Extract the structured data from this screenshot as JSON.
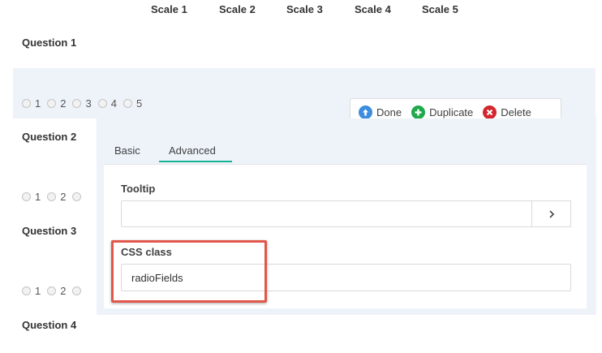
{
  "scale_headers": [
    "Scale 1",
    "Scale 2",
    "Scale 3",
    "Scale 4",
    "Scale 5"
  ],
  "questions": [
    {
      "label": "Question 1"
    },
    {
      "label": "Question 2"
    },
    {
      "label": "Question 3"
    },
    {
      "label": "Question 4"
    }
  ],
  "q1_options": [
    "1",
    "2",
    "3",
    "4",
    "5"
  ],
  "q2_options": [
    "1",
    "2"
  ],
  "q3_options": [
    "1",
    "2"
  ],
  "toolbar": {
    "done_label": "Done",
    "duplicate_label": "Duplicate",
    "delete_label": "Delete"
  },
  "tabs": [
    {
      "label": "Basic",
      "active": false
    },
    {
      "label": "Advanced",
      "active": true
    }
  ],
  "fields": {
    "tooltip_label": "Tooltip",
    "tooltip_value": "",
    "css_label": "CSS class",
    "css_value": "radioFields"
  },
  "colors": {
    "accent": "#19b394",
    "done_icon": "#3c8dde",
    "duplicate_icon": "#1ea94b",
    "delete_icon": "#d3262d",
    "highlight": "#e2574c",
    "selected_bg": "#eef3fa"
  }
}
